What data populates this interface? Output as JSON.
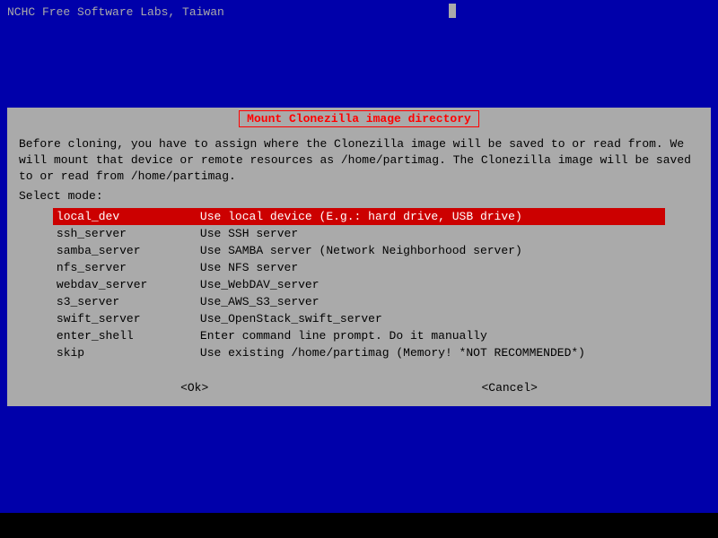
{
  "header": {
    "title": "NCHC Free Software Labs, Taiwan"
  },
  "dialog": {
    "title": "Mount Clonezilla image directory",
    "description_line1": "Before cloning, you have to assign where the Clonezilla image will be saved to or read from. We",
    "description_line2": "will mount that device or remote resources as /home/partimag. The Clonezilla image will be saved",
    "description_line3": "to or read from /home/partimag.",
    "select_mode_label": "Select mode:",
    "options": [
      {
        "key": "local_dev",
        "desc": "Use local device (E.g.: hard drive, USB drive)",
        "selected": true
      },
      {
        "key": "ssh_server",
        "desc": "Use SSH server",
        "selected": false
      },
      {
        "key": "samba_server",
        "desc": "Use SAMBA server (Network Neighborhood server)",
        "selected": false
      },
      {
        "key": "nfs_server",
        "desc": "Use NFS server",
        "selected": false
      },
      {
        "key": "webdav_server",
        "desc": "Use_WebDAV_server",
        "selected": false
      },
      {
        "key": "s3_server",
        "desc": "Use_AWS_S3_server",
        "selected": false
      },
      {
        "key": "swift_server",
        "desc": "Use_OpenStack_swift_server",
        "selected": false
      },
      {
        "key": "enter_shell",
        "desc": "Enter command line prompt. Do it manually",
        "selected": false
      },
      {
        "key": "skip",
        "desc": "Use existing /home/partimag (Memory! *NOT RECOMMENDED*)",
        "selected": false
      }
    ],
    "ok_button": "<Ok>",
    "cancel_button": "<Cancel>"
  }
}
